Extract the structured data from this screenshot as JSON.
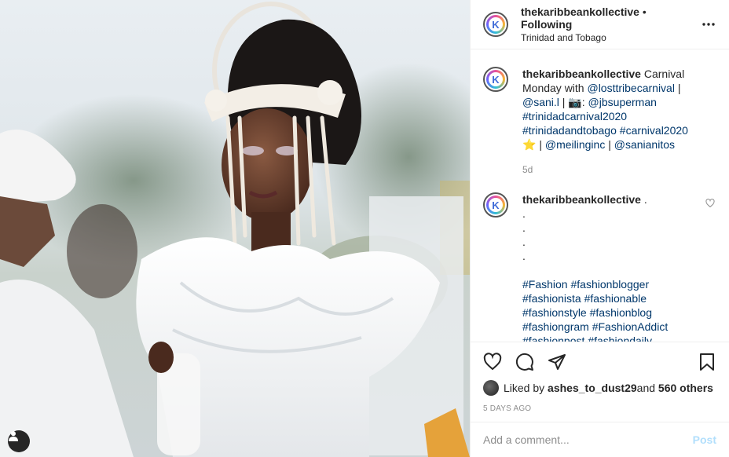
{
  "header": {
    "username": "thekaribbeankollective",
    "separator": " • ",
    "follow_status": "Following",
    "location": "Trinidad and Tobago",
    "avatar_letter": "K"
  },
  "caption": {
    "username": "thekaribbeankollective",
    "text_1": " Carnival Monday with ",
    "mention_1": "@losttribecarnival",
    "text_2": " | ",
    "mention_2": "@sani.l",
    "text_3": " | 📷: ",
    "mention_3": "@jbsuperman",
    "hashtag_1": "#trinidadcarnival2020",
    "hashtag_2": "#trinidadandtobago",
    "hashtag_3": "#carnival2020",
    "text_4": " ⭐",
    "text_5": "| ",
    "mention_4": "@meilinginc",
    "text_6": " | ",
    "mention_5": "@sanianitos",
    "age": "5d"
  },
  "comment": {
    "username": "thekaribbeankollective",
    "text": " .",
    "dots": [
      ".",
      ".",
      ".",
      "."
    ],
    "hashtags": [
      "#Fashion",
      "#fashionblogger",
      "#fashionista",
      "#fashionable",
      "#fashionstyle",
      "#fashionblog",
      "#fashiongram",
      "#FashionAddict",
      "#fashionpost",
      "#fashiondaily"
    ]
  },
  "actions": {
    "like_icon": "heart-icon",
    "comment_icon": "comment-icon",
    "share_icon": "paper-plane-icon",
    "save_icon": "bookmark-icon"
  },
  "likes": {
    "prefix": "Liked by ",
    "user": "ashes_to_dust29",
    "middle": " and ",
    "count": "560 others"
  },
  "date": "5 DAYS AGO",
  "add_comment": {
    "placeholder": "Add a comment...",
    "post_label": "Post"
  },
  "colors": {
    "link": "#00376b",
    "post_disabled": "#b2dffc",
    "muted": "#8e8e8e"
  }
}
